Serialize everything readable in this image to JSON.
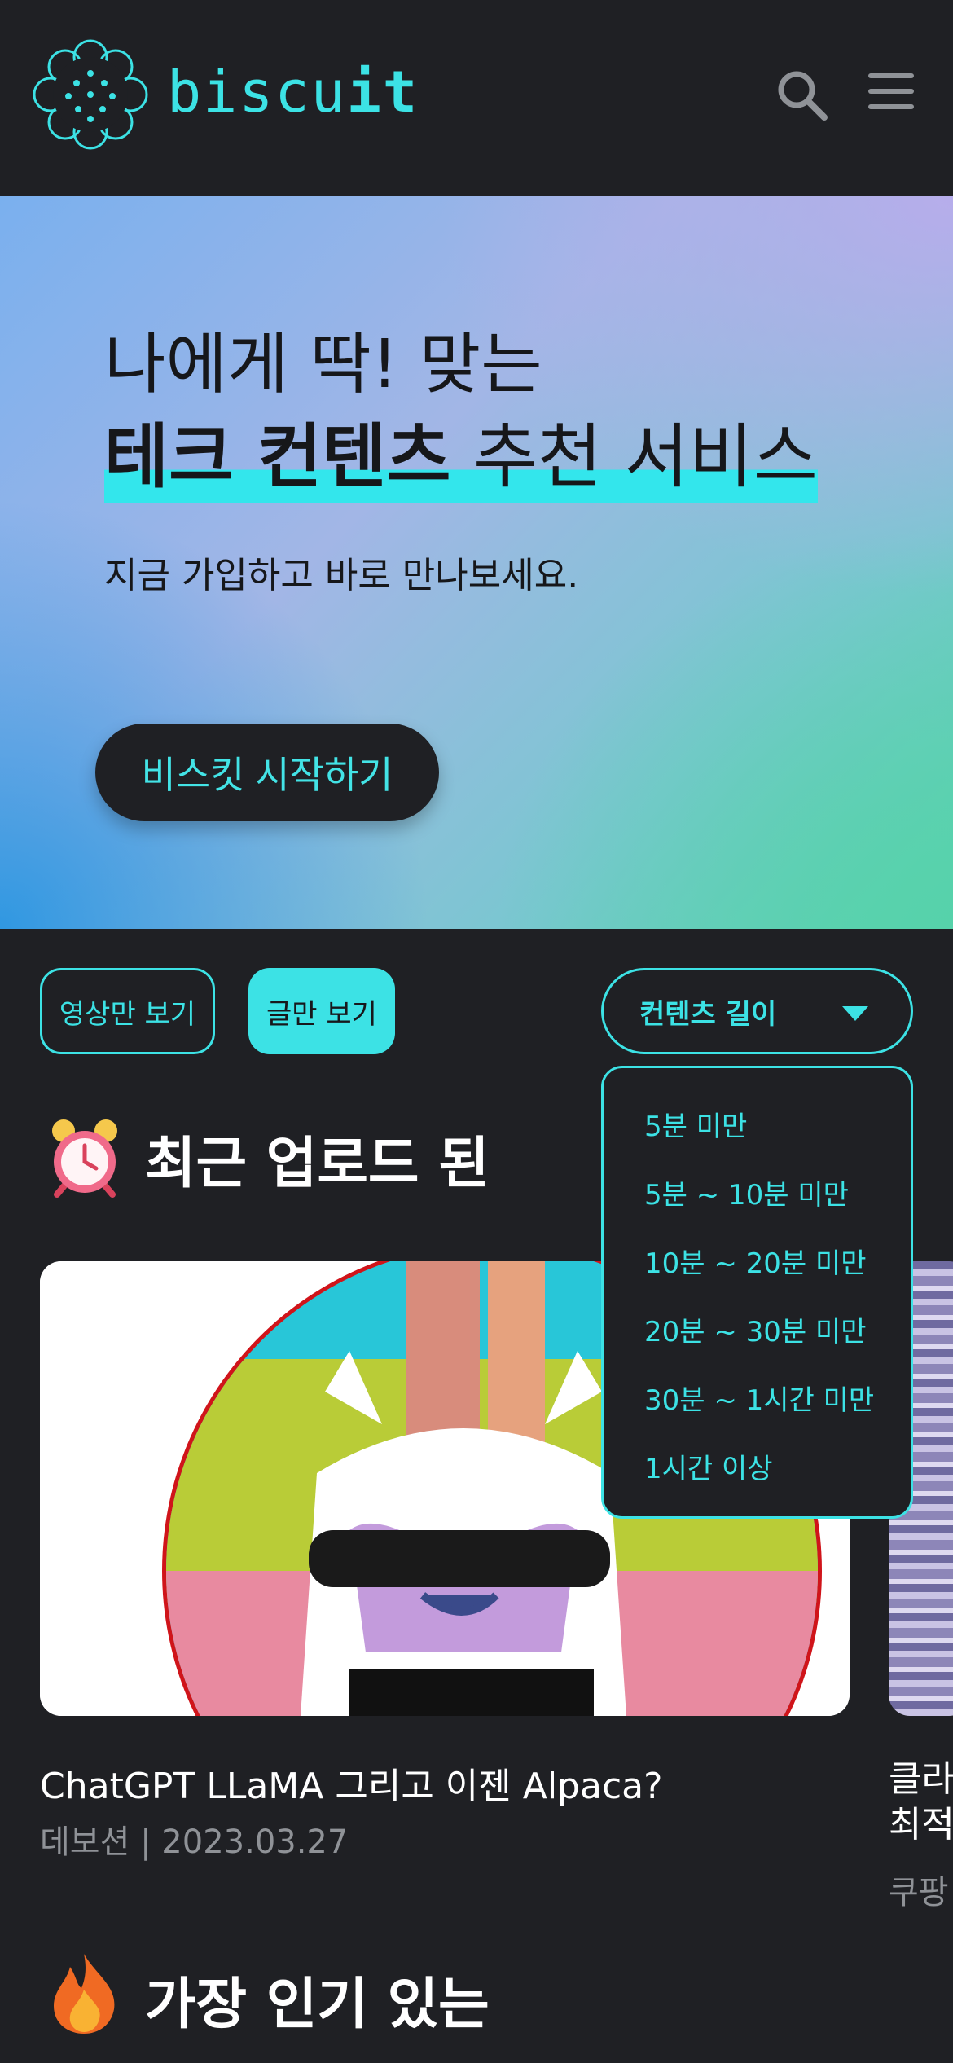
{
  "header": {
    "logo_text_light": "biscu",
    "logo_text_bold": "it"
  },
  "hero": {
    "line1": "나에게 딱! 맞는",
    "line2_highlight": "테크 컨텐츠",
    "line2_rest": " 추천 서비스",
    "subtitle": "지금 가입하고 바로 만나보세요.",
    "cta_label": "비스킷 시작하기"
  },
  "filters": {
    "video_only": "영상만 보기",
    "text_only": "글만 보기",
    "length_label": "컨텐츠 길이",
    "length_options": [
      "5분 미만",
      "5분 ~ 10분 미만",
      "10분 ~ 20분 미만",
      "20분 ~ 30분 미만",
      "30분 ~ 1시간 미만",
      "1시간 이상"
    ]
  },
  "sections": {
    "recent_title": "최근 업로드 된",
    "popular_title": "가장 인기 있는"
  },
  "cards": [
    {
      "title": "ChatGPT LLaMA 그리고 이젠 Alpaca?",
      "meta": "데보션 | 2023.03.27"
    },
    {
      "title_line1": "클라",
      "title_line2": "최적",
      "meta": "쿠팡"
    }
  ],
  "colors": {
    "accent": "#3ce2e5",
    "background": "#1f2024",
    "muted": "#8f9297"
  }
}
